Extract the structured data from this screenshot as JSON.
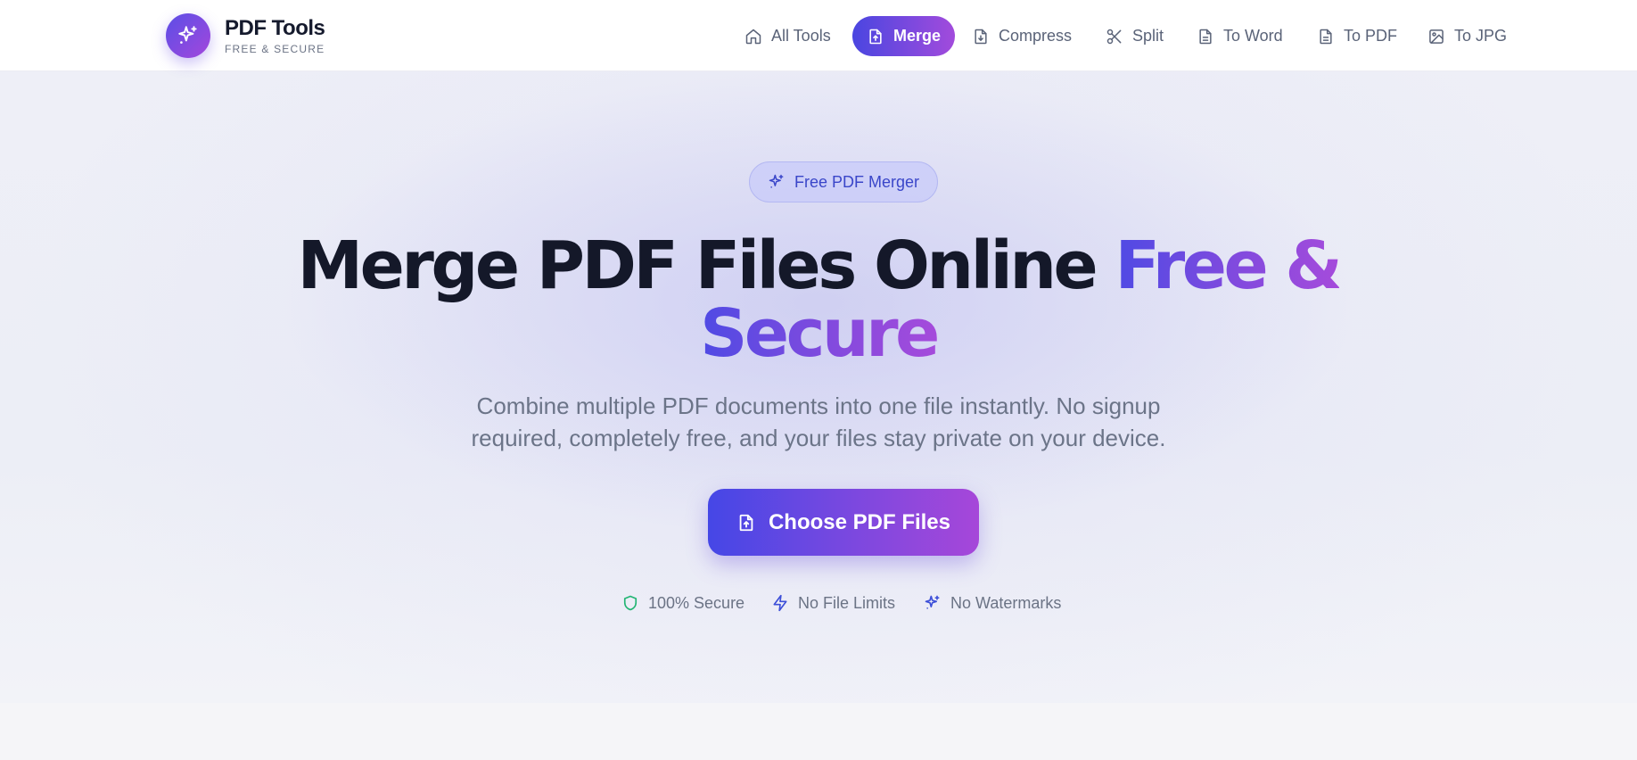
{
  "brand": {
    "name": "PDF Tools",
    "tagline": "FREE & SECURE",
    "logo_icon": "sparkles-icon"
  },
  "nav": {
    "items": [
      {
        "label": "All Tools",
        "icon": "home-icon",
        "active": false
      },
      {
        "label": "Merge",
        "icon": "file-upload-icon",
        "active": true
      },
      {
        "label": "Compress",
        "icon": "file-download-icon",
        "active": false
      },
      {
        "label": "Split",
        "icon": "scissors-icon",
        "active": false
      },
      {
        "label": "To Word",
        "icon": "file-text-icon",
        "active": false
      },
      {
        "label": "To PDF",
        "icon": "file-text-icon",
        "active": false
      },
      {
        "label": "To JPG",
        "icon": "image-icon",
        "active": false
      }
    ]
  },
  "hero": {
    "badge": "Free PDF Merger",
    "headline_dark": "Merge PDF Files Online",
    "headline_accent_1": "Free &",
    "headline_accent_2": "Secure",
    "subtitle": "Combine multiple PDF documents into one file instantly. No signup required, completely free, and your files stay private on your device.",
    "cta_label": "Choose PDF Files",
    "features": [
      {
        "label": "100% Secure",
        "icon": "shield-icon"
      },
      {
        "label": "No File Limits",
        "icon": "zap-icon"
      },
      {
        "label": "No Watermarks",
        "icon": "sparkles-icon"
      }
    ]
  },
  "colors": {
    "accent_start": "#4a46e0",
    "accent_end": "#a24bdc",
    "secure_green": "#22b573",
    "blue_icon": "#3d4fd8"
  }
}
